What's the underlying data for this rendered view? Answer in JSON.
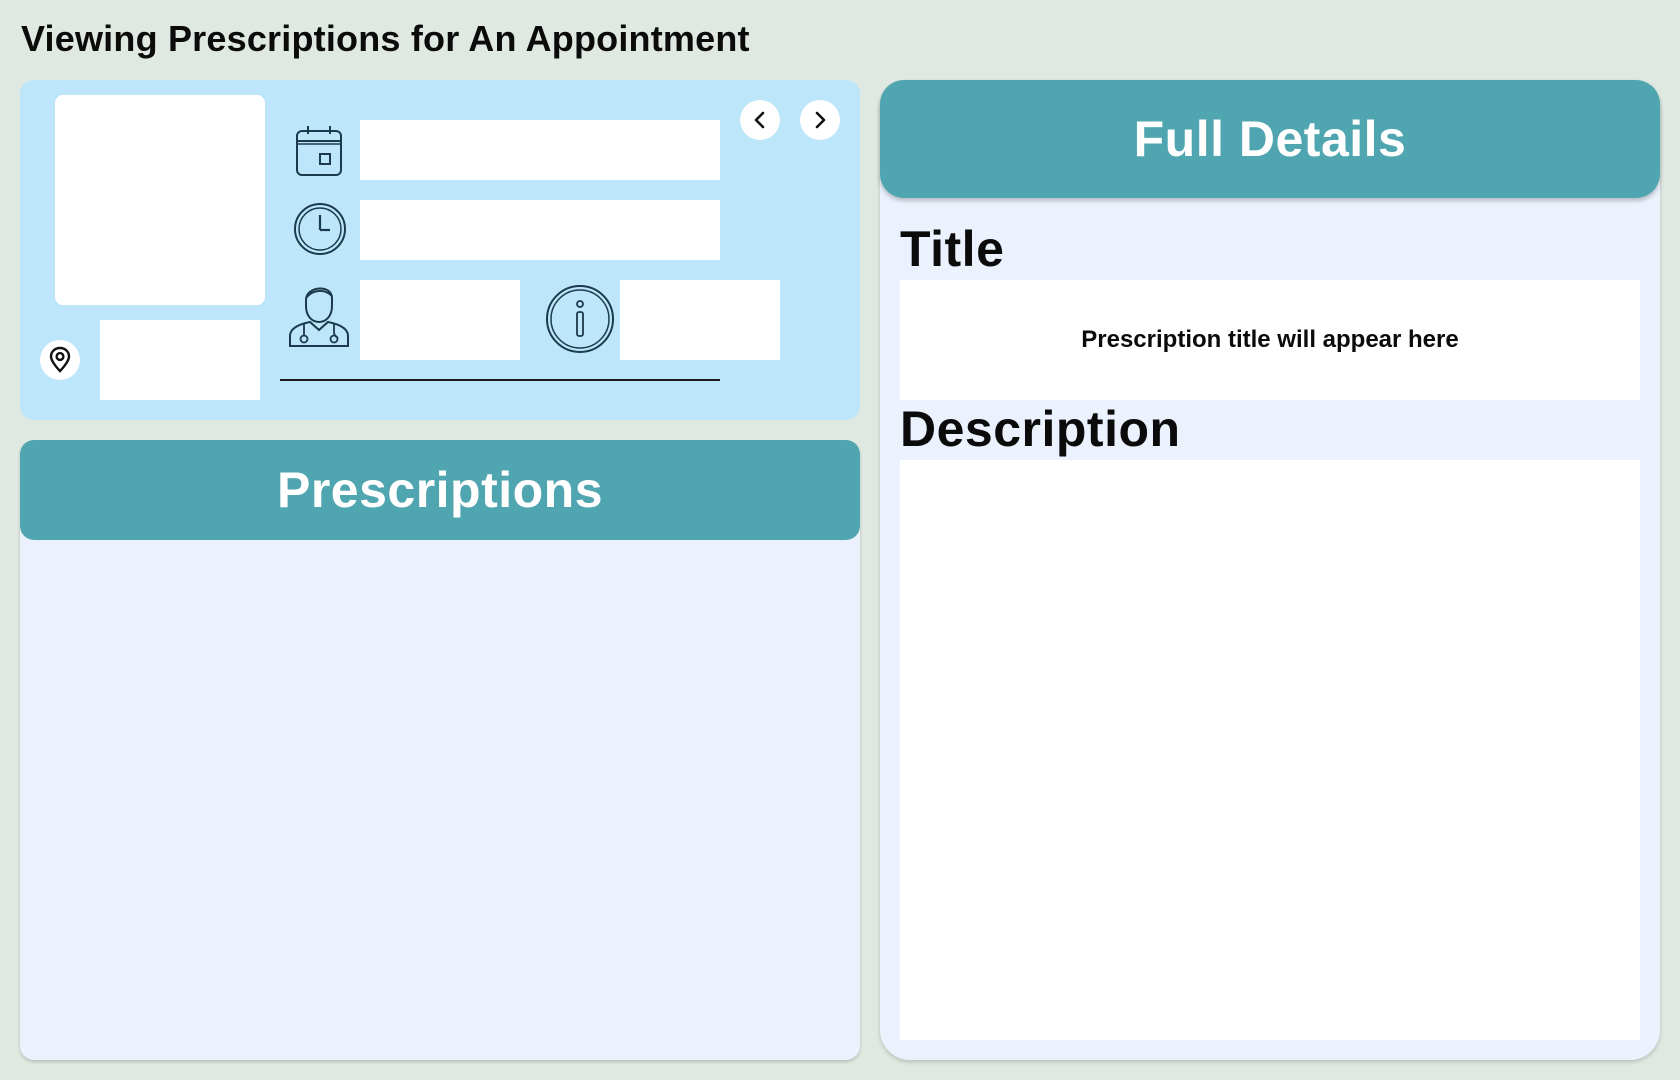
{
  "page": {
    "title": "Viewing Prescriptions for An Appointment"
  },
  "appointment": {
    "photo": "",
    "date": "",
    "time": "",
    "doctor": "",
    "status": "",
    "location": "",
    "icons": {
      "date": "calendar-icon",
      "time": "clock-icon",
      "doctor": "doctor-icon",
      "status": "info-icon",
      "location": "location-pin-icon",
      "prev": "chevron-left-icon",
      "next": "chevron-right-icon"
    }
  },
  "prescriptions": {
    "header": "Prescriptions",
    "items": []
  },
  "details": {
    "header": "Full Details",
    "title_label": "Title",
    "title_value": "Prescription title will appear here",
    "description_label": "Description",
    "description_value": ""
  },
  "colors": {
    "background": "#dfe9e1",
    "card": "#bde6fb",
    "header": "#50a6b0",
    "panel": "#ebf2fd",
    "field": "#ffffff"
  }
}
